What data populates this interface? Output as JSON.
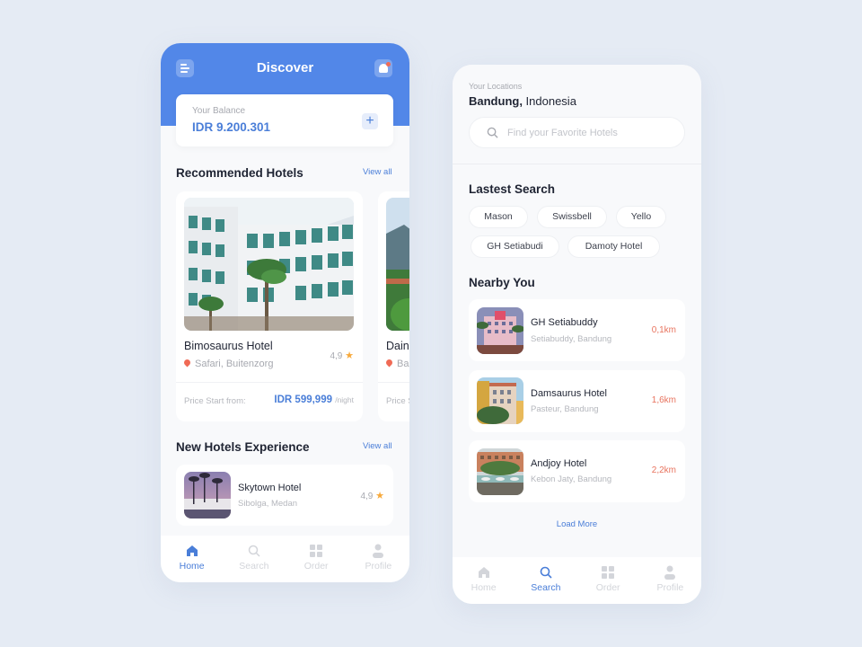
{
  "home_screen": {
    "title": "Discover",
    "balance": {
      "label": "Your Balance",
      "value": "IDR 9.200.301",
      "add_icon": "plus-icon"
    },
    "recommended": {
      "title": "Recommended Hotels",
      "view_all": "View all",
      "cards": [
        {
          "name": "Bimosaurus Hotel",
          "location": "Safari, Buitenzorg",
          "rating": "4,9",
          "price_label": "Price Start from:",
          "price": "IDR 599,999",
          "price_unit": "/night"
        },
        {
          "name": "Dain",
          "location": "Ba",
          "price_label": "Price S"
        }
      ]
    },
    "new_hotels": {
      "title": "New Hotels Experience",
      "view_all": "View all",
      "items": [
        {
          "name": "Skytown Hotel",
          "location": "Sibolga, Medan",
          "rating": "4,9"
        }
      ]
    },
    "nav": [
      {
        "label": "Home",
        "icon": "home-icon",
        "active": true
      },
      {
        "label": "Search",
        "icon": "search-icon",
        "active": false
      },
      {
        "label": "Order",
        "icon": "grid-icon",
        "active": false
      },
      {
        "label": "Profile",
        "icon": "user-icon",
        "active": false
      }
    ]
  },
  "search_screen": {
    "location_label": "Your Locations",
    "location_city": "Bandung,",
    "location_country": " Indonesia",
    "search_placeholder": "Find your Favorite Hotels",
    "latest_search": {
      "title": "Lastest Search",
      "chips": [
        "Mason",
        "Swissbell",
        "Yello",
        "GH Setiabudi",
        "Damoty Hotel"
      ]
    },
    "nearby": {
      "title": "Nearby You",
      "items": [
        {
          "name": "GH Setiabuddy",
          "location": "Setiabuddy, Bandung",
          "distance": "0,1km"
        },
        {
          "name": "Damsaurus Hotel",
          "location": "Pasteur, Bandung",
          "distance": "1,6km"
        },
        {
          "name": "Andjoy Hotel",
          "location": "Kebon Jaty, Bandung",
          "distance": "2,2km"
        }
      ],
      "load_more": "Load More"
    },
    "nav": [
      {
        "label": "Home",
        "icon": "home-icon",
        "active": false
      },
      {
        "label": "Search",
        "icon": "search-icon",
        "active": true
      },
      {
        "label": "Order",
        "icon": "grid-icon",
        "active": false
      },
      {
        "label": "Profile",
        "icon": "user-icon",
        "active": false
      }
    ]
  },
  "colors": {
    "primary": "#5287e8",
    "accent_text": "#4a7ed8",
    "distance": "#e8735e",
    "star": "#f7a93b",
    "background": "#e5ebf4"
  }
}
